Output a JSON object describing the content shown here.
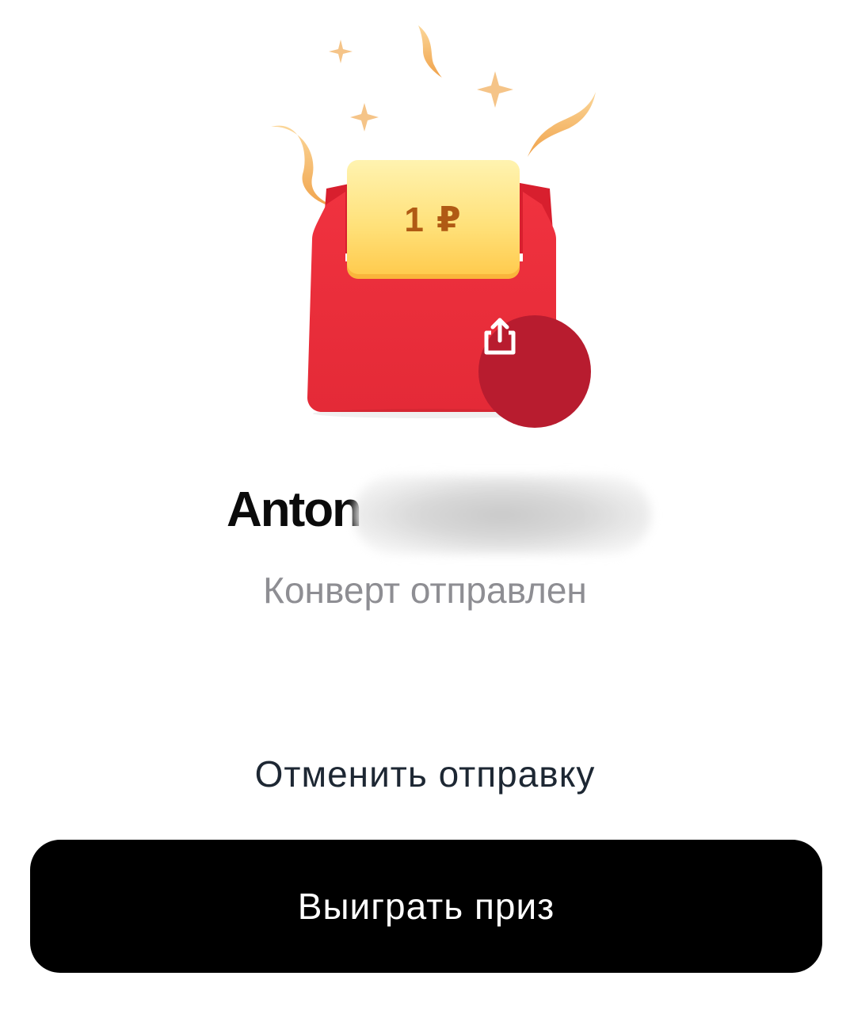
{
  "envelope": {
    "amount": "1 ₽",
    "share_icon": "share-icon"
  },
  "recipient": {
    "name_visible": "Anton"
  },
  "status": {
    "text": "Конверт отправлен"
  },
  "actions": {
    "cancel_label": "Отменить отправку",
    "primary_label": "Выиграть приз"
  },
  "colors": {
    "envelope_red": "#e8323e",
    "share_button": "#b81c2f",
    "primary_button": "#000000",
    "status_gray": "#8e8e93"
  }
}
